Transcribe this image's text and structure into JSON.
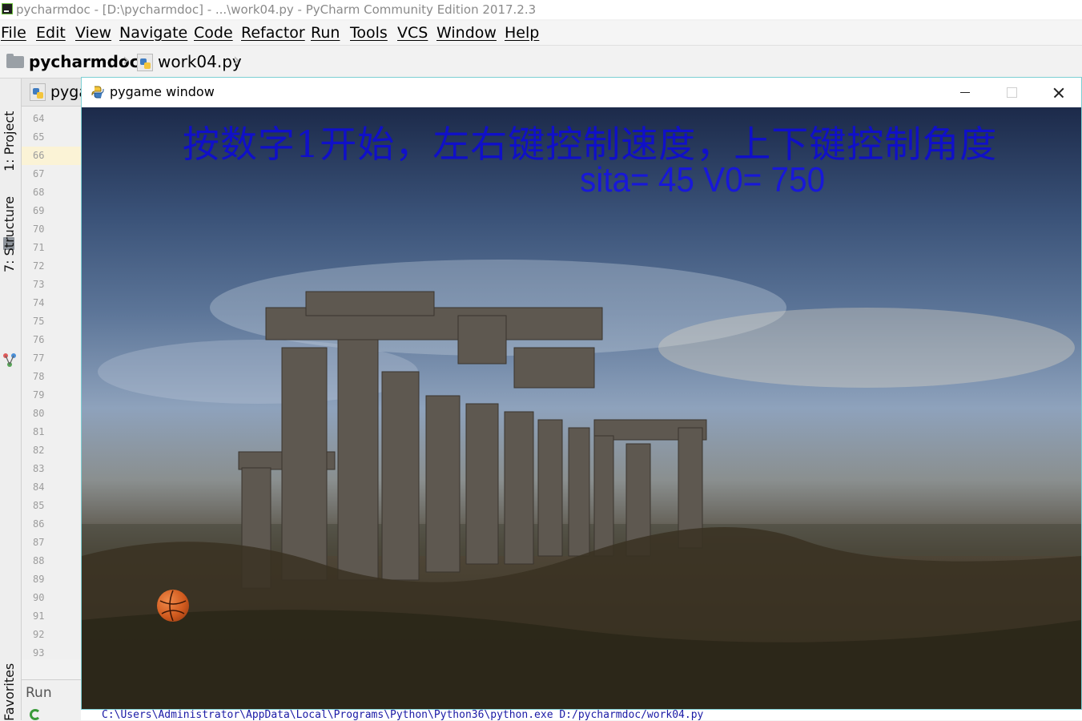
{
  "ide": {
    "window_title": "pycharmdoc - [D:\\pycharmdoc] - ...\\work04.py - PyCharm Community Edition 2017.2.3",
    "menu": [
      {
        "label": "File"
      },
      {
        "label": "Edit"
      },
      {
        "label": "View"
      },
      {
        "label": "Navigate"
      },
      {
        "label": "Code"
      },
      {
        "label": "Refactor"
      },
      {
        "label": "Run"
      },
      {
        "label": "Tools"
      },
      {
        "label": "VCS"
      },
      {
        "label": "Window"
      },
      {
        "label": "Help"
      }
    ],
    "breadcrumb": {
      "project": "pycharmdoc",
      "file": "work04.py"
    },
    "tool_windows": {
      "project": "1: Project",
      "structure": "7: Structure",
      "favorites": "Favorites"
    },
    "editor_tab_partial": "pyga",
    "line_numbers": [
      "64",
      "65",
      "66",
      "67",
      "68",
      "69",
      "70",
      "71",
      "72",
      "73",
      "74",
      "75",
      "76",
      "77",
      "78",
      "79",
      "80",
      "81",
      "82",
      "83",
      "84",
      "85",
      "86",
      "87",
      "88",
      "89",
      "90",
      "91",
      "92",
      "93"
    ],
    "current_line": "66",
    "run_panel": {
      "label": "Run",
      "output": "C:\\Users\\Administrator\\AppData\\Local\\Programs\\Python\\Python36\\python.exe D:/pycharmdoc/work04.py"
    }
  },
  "pygame": {
    "window_title": "pygame window",
    "instruction": "按数字1开始，左右键控制速度，上下键控制角度",
    "status": "sita= 45 V0= 750",
    "text_color": "#1010c8"
  }
}
